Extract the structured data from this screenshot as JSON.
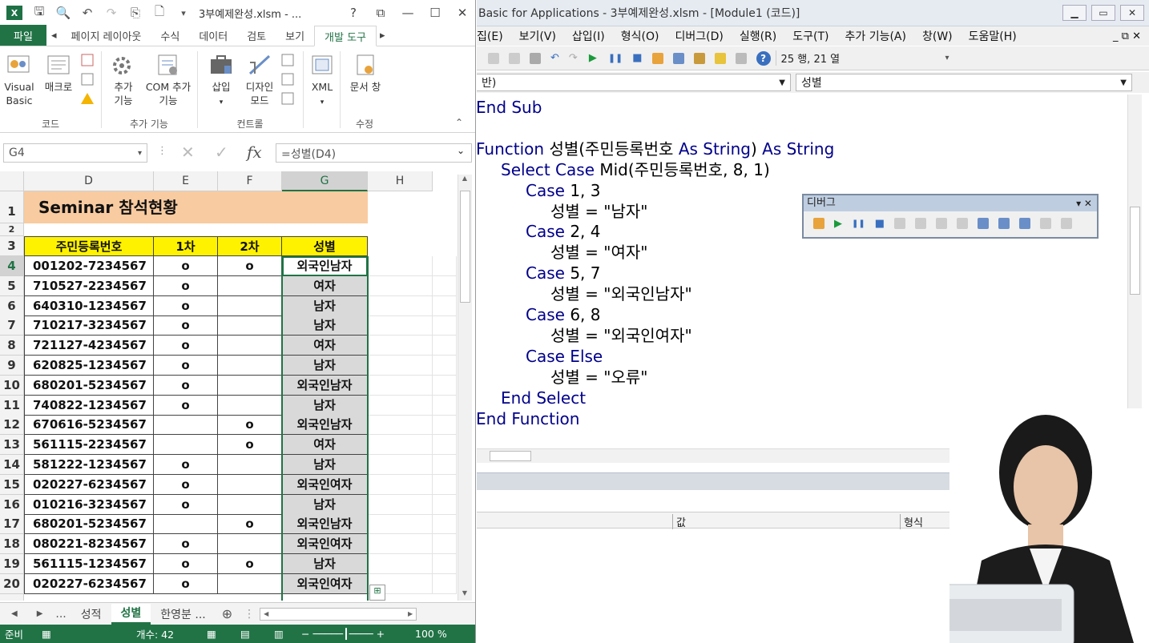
{
  "excel": {
    "title": "3부예제완성.xlsm - ...",
    "help": "?",
    "tabs": [
      "파일",
      "페이지 레이아웃",
      "수식",
      "데이터",
      "검토",
      "보기",
      "개발 도구"
    ],
    "ribbon": {
      "visual_basic": "Visual Basic",
      "macro": "매크로",
      "addin": "추가 기능",
      "com_addin": "COM 추가 기능",
      "insert": "삽입",
      "design_mode": "디자인 모드",
      "xml": "XML",
      "doc_pane": "문서 창",
      "groups": {
        "code": "코드",
        "addins": "추가 기능",
        "controls": "컨트롤",
        "modify": "수정"
      }
    },
    "name_box": "G4",
    "fx": "fx",
    "formula": "=성별(D4)",
    "columns": [
      "D",
      "E",
      "F",
      "G",
      "H"
    ],
    "title_cell": "Seminar 참석현황",
    "headers": [
      "주민등록번호",
      "1차",
      "2차",
      "성별"
    ],
    "rows": [
      {
        "n": "4",
        "id": "001202-7234567",
        "c1": "o",
        "c2": "o",
        "g": "외국인남자"
      },
      {
        "n": "5",
        "id": "710527-2234567",
        "c1": "o",
        "c2": "",
        "g": "여자"
      },
      {
        "n": "6",
        "id": "640310-1234567",
        "c1": "o",
        "c2": "",
        "g": "남자"
      },
      {
        "n": "7",
        "id": "710217-3234567",
        "c1": "o",
        "c2": "",
        "g": "남자"
      },
      {
        "n": "8",
        "id": "721127-4234567",
        "c1": "o",
        "c2": "",
        "g": "여자"
      },
      {
        "n": "9",
        "id": "620825-1234567",
        "c1": "o",
        "c2": "",
        "g": "남자"
      },
      {
        "n": "10",
        "id": "680201-5234567",
        "c1": "o",
        "c2": "",
        "g": "외국인남자"
      },
      {
        "n": "11",
        "id": "740822-1234567",
        "c1": "o",
        "c2": "",
        "g": "남자"
      },
      {
        "n": "12",
        "id": "670616-5234567",
        "c1": "",
        "c2": "o",
        "g": "외국인남자"
      },
      {
        "n": "13",
        "id": "561115-2234567",
        "c1": "",
        "c2": "o",
        "g": "여자"
      },
      {
        "n": "14",
        "id": "581222-1234567",
        "c1": "o",
        "c2": "",
        "g": "남자"
      },
      {
        "n": "15",
        "id": "020227-6234567",
        "c1": "o",
        "c2": "",
        "g": "외국인여자"
      },
      {
        "n": "16",
        "id": "010216-3234567",
        "c1": "o",
        "c2": "",
        "g": "남자"
      },
      {
        "n": "17",
        "id": "680201-5234567",
        "c1": "",
        "c2": "o",
        "g": "외국인남자"
      },
      {
        "n": "18",
        "id": "080221-8234567",
        "c1": "o",
        "c2": "",
        "g": "외국인여자"
      },
      {
        "n": "19",
        "id": "561115-1234567",
        "c1": "o",
        "c2": "o",
        "g": "남자"
      },
      {
        "n": "20",
        "id": "020227-6234567",
        "c1": "o",
        "c2": "",
        "g": "외국인여자"
      }
    ],
    "sheet_tabs": [
      "성적",
      "성별",
      "한영분 ..."
    ],
    "status": {
      "ready": "준비",
      "count": "개수: 42",
      "zoom": "100 %"
    },
    "colors": {
      "green": "#217346",
      "title_fill": "#f8cba0",
      "header_fill": "#fff200",
      "g_fill": "#d9d9d9"
    }
  },
  "vba": {
    "title": "Basic for Applications - 3부예제완성.xlsm - [Module1 (코드)]",
    "menu": [
      "집(E)",
      "보기(V)",
      "삽입(I)",
      "형식(O)",
      "디버그(D)",
      "실행(R)",
      "도구(T)",
      "추가 기능(A)",
      "창(W)",
      "도움말(H)"
    ],
    "cursor_pos": "25 행, 21 열",
    "object_combo": "반)",
    "proc_combo": "성별",
    "code": [
      {
        "indent": 0,
        "parts": [
          [
            "kw",
            "End Sub"
          ]
        ]
      },
      {
        "indent": 0,
        "parts": [
          [
            "",
            ""
          ]
        ]
      },
      {
        "indent": 0,
        "parts": [
          [
            "kw",
            "Function "
          ],
          [
            "",
            "성별(주민등록번호 "
          ],
          [
            "kw",
            "As String"
          ],
          [
            "",
            ") "
          ],
          [
            "kw",
            "As String"
          ]
        ]
      },
      {
        "indent": 1,
        "parts": [
          [
            "kw",
            "Select Case "
          ],
          [
            "",
            "Mid(주민등록번호, 8, 1)"
          ]
        ]
      },
      {
        "indent": 2,
        "parts": [
          [
            "kw",
            "Case "
          ],
          [
            "",
            "1, 3"
          ]
        ]
      },
      {
        "indent": 3,
        "parts": [
          [
            "",
            "성별 = \"남자\""
          ]
        ]
      },
      {
        "indent": 2,
        "parts": [
          [
            "kw",
            "Case "
          ],
          [
            "",
            "2, 4"
          ]
        ]
      },
      {
        "indent": 3,
        "parts": [
          [
            "",
            "성별 = \"여자\""
          ]
        ]
      },
      {
        "indent": 2,
        "parts": [
          [
            "kw",
            "Case "
          ],
          [
            "",
            "5, 7"
          ]
        ]
      },
      {
        "indent": 3,
        "parts": [
          [
            "",
            "성별 = \"외국인남자\""
          ]
        ]
      },
      {
        "indent": 2,
        "parts": [
          [
            "kw",
            "Case "
          ],
          [
            "",
            "6, 8"
          ]
        ]
      },
      {
        "indent": 3,
        "parts": [
          [
            "",
            "성별 = \"외국인여자\""
          ]
        ]
      },
      {
        "indent": 2,
        "parts": [
          [
            "kw",
            "Case Else"
          ]
        ]
      },
      {
        "indent": 3,
        "parts": [
          [
            "",
            "성별 = \"오류\""
          ]
        ]
      },
      {
        "indent": 1,
        "parts": [
          [
            "kw",
            "End Select"
          ]
        ]
      },
      {
        "indent": 0,
        "parts": [
          [
            "kw",
            "End Function"
          ]
        ]
      }
    ],
    "debug_toolbar_title": "디버그",
    "watch_columns": [
      "값",
      "형식"
    ]
  }
}
